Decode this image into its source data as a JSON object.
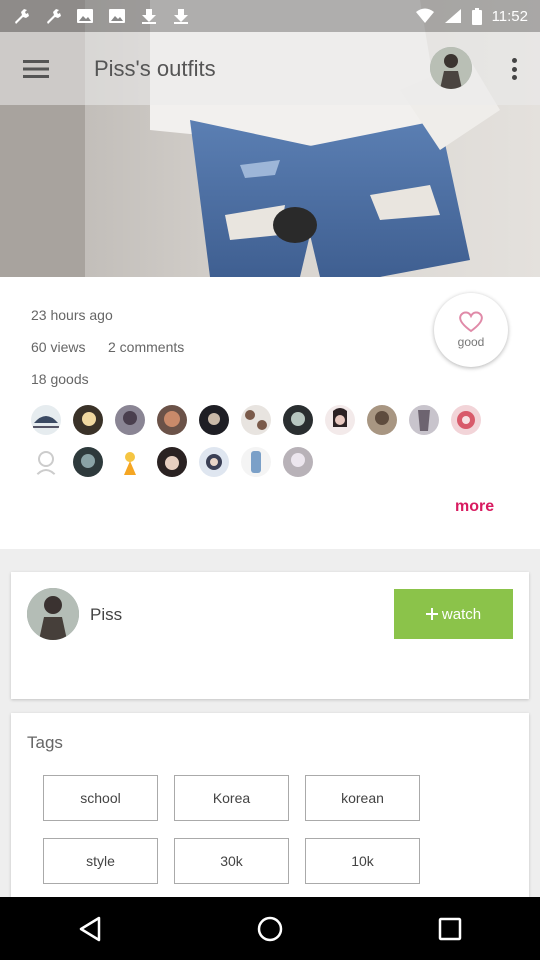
{
  "status_bar": {
    "time": "11:52",
    "left_icons": [
      "wrench-icon",
      "wrench-icon",
      "image-icon",
      "image-icon",
      "download-icon",
      "download-icon"
    ],
    "right_icons": [
      "wifi-icon",
      "signal-icon",
      "battery-icon"
    ]
  },
  "app_bar": {
    "title": "Piss's outfits",
    "menu_icon": "hamburger-menu-icon",
    "overflow_icon": "more-vert-icon"
  },
  "post": {
    "time_ago": "23 hours ago",
    "views": "60 views",
    "comments": "2 comments",
    "goods": "18 goods",
    "good_button_label": "good",
    "more_label": "more",
    "likers_row1_count": 11,
    "likers_row2_count": 7
  },
  "user": {
    "name": "Piss",
    "watch_label": "watch"
  },
  "tags": {
    "title": "Tags",
    "items": [
      "school",
      "Korea",
      "korean",
      "style",
      "30k",
      "10k"
    ]
  },
  "colors": {
    "accent": "#d81b60",
    "watch_green": "#8bc34a",
    "heart": "#e08aa8"
  }
}
